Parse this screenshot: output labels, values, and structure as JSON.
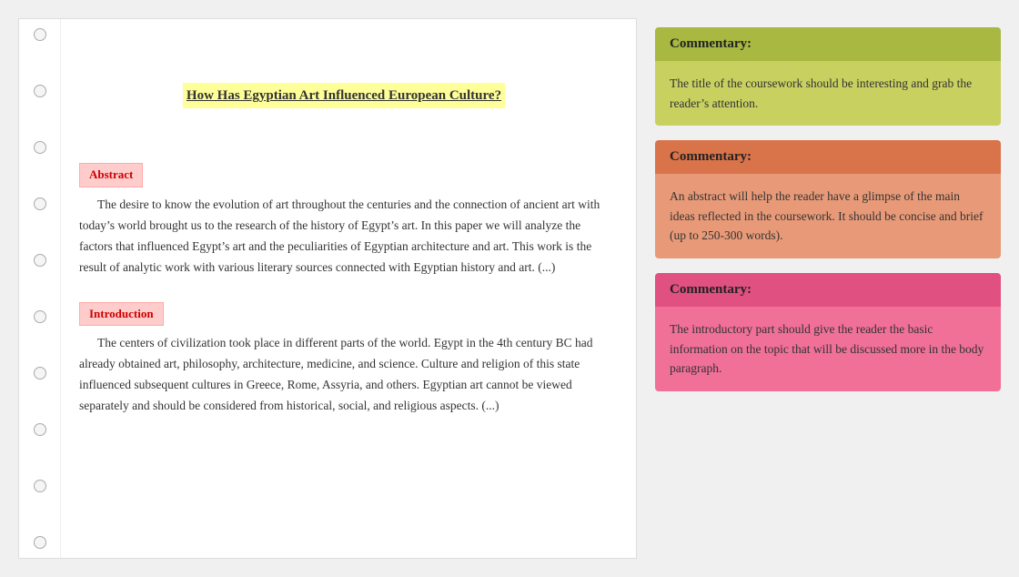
{
  "document": {
    "title": "How Has Egyptian Art Influenced European Culture?",
    "bullets_count": 10,
    "abstract_label": "Abstract",
    "abstract_text": "The desire to know the evolution of art throughout the centuries and the connection of ancient art with today’s world brought us to the research of the history of Egypt’s art. In this paper we will analyze the factors that influenced Egypt’s art and the peculiarities of Egyptian architecture and art. This work is the result of analytic work with various literary sources connected with Egyptian history and art. (...)",
    "introduction_label": "Introduction",
    "introduction_text": "The centers of civilization took place in different parts of the world. Egypt in the 4th century BC had already obtained art, philosophy, architecture, medicine, and science. Culture and religion of this state influenced subsequent cultures in Greece, Rome, Assyria, and others. Egyptian art cannot be viewed separately and should be considered from historical, social, and religious aspects. (...)"
  },
  "commentaries": [
    {
      "id": "commentary-1",
      "header": "Commentary:",
      "body": "The title of the coursework should be interesting and grab the reader’s attention."
    },
    {
      "id": "commentary-2",
      "header": "Commentary:",
      "body": "An abstract will help the reader have a glimpse of the main ideas reflected in the coursework. It should be concise and brief (up to 250-300 words)."
    },
    {
      "id": "commentary-3",
      "header": "Commentary:",
      "body": "The introductory part should give the reader the basic information on the topic that will be discussed more in the body paragraph."
    }
  ]
}
